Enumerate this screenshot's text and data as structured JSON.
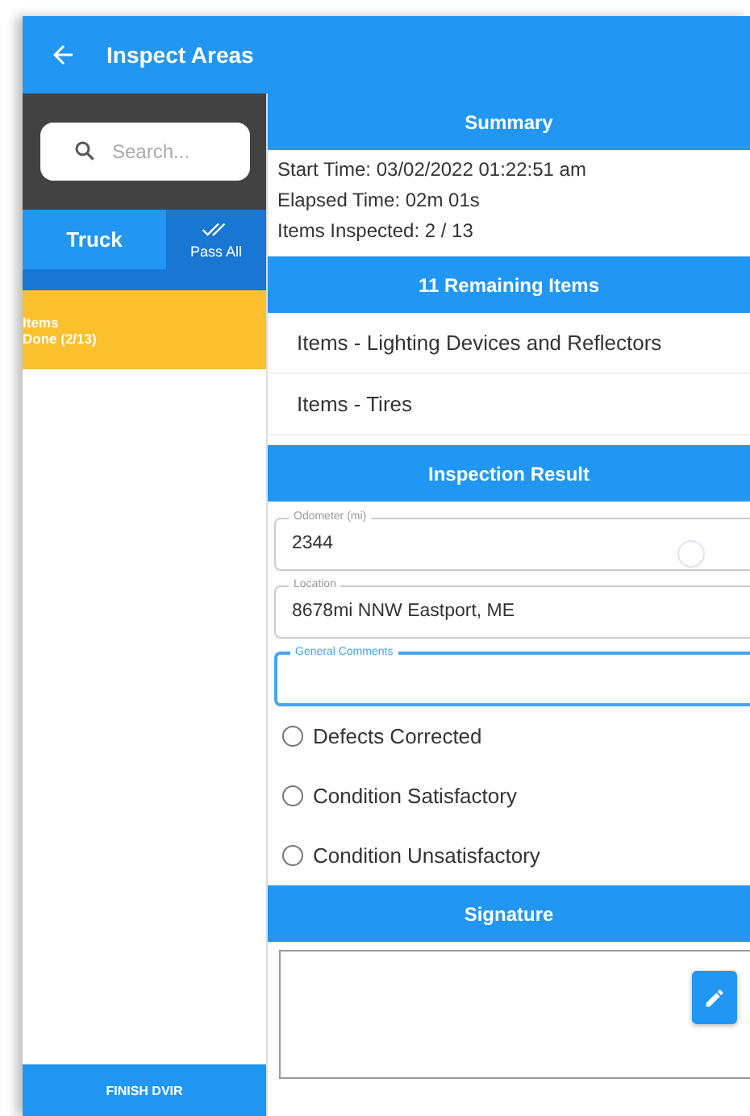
{
  "app_bar": {
    "title": "Inspect Areas"
  },
  "sidebar": {
    "search": {
      "placeholder": "Search..."
    },
    "tabs": [
      {
        "label": "Truck",
        "kind": "text",
        "selected": true
      },
      {
        "label": "Pass All",
        "kind": "icon",
        "selected": false
      }
    ],
    "areas": [
      {
        "title": "Items",
        "status": "Done (2/13)",
        "selected": true
      }
    ],
    "finish_button": "FINISH DVIR"
  },
  "summary": {
    "title": "Summary",
    "lines": [
      "Start Time: 03/02/2022 01:22:51 am",
      "Elapsed Time: 02m 01s",
      "Items Inspected: 2 / 13"
    ]
  },
  "remaining": {
    "title": "11 Remaining Items",
    "items": [
      "Items - Lighting Devices and Reflectors",
      "Items - Tires"
    ]
  },
  "inspection_result": {
    "title": "Inspection Result",
    "fields": [
      {
        "label": "Odometer (mi)",
        "value": "2344",
        "loading": true,
        "focused": false
      },
      {
        "label": "Location",
        "value": "8678mi NNW Eastport, ME",
        "loading": false,
        "focused": false
      },
      {
        "label": "General Comments",
        "loading": false,
        "focused": true
      }
    ],
    "options": [
      {
        "label": "Defects Corrected",
        "selected": false
      },
      {
        "label": "Condition Satisfactory",
        "selected": false
      },
      {
        "label": "Condition Unsatisfactory",
        "selected": false
      }
    ]
  },
  "signature": {
    "title": "Signature"
  }
}
